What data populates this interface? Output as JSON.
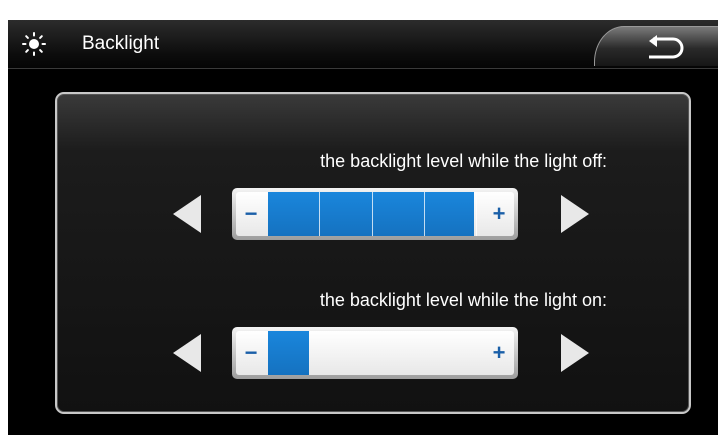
{
  "header": {
    "title": "Backlight",
    "icon": "sun-icon",
    "back_icon": "back-return-icon"
  },
  "settings": [
    {
      "label": "the backlight level while the light off:",
      "minus": "−",
      "plus": "+",
      "level": 5,
      "max_level": 5,
      "fill_color": "#1a86dc"
    },
    {
      "label": "the backlight level while the light on:",
      "minus": "−",
      "plus": "+",
      "level": 1,
      "max_level": 5,
      "fill_color": "#1a86dc"
    }
  ],
  "colors": {
    "background": "#000000",
    "accent": "#1a86dc",
    "text": "#ffffff"
  }
}
